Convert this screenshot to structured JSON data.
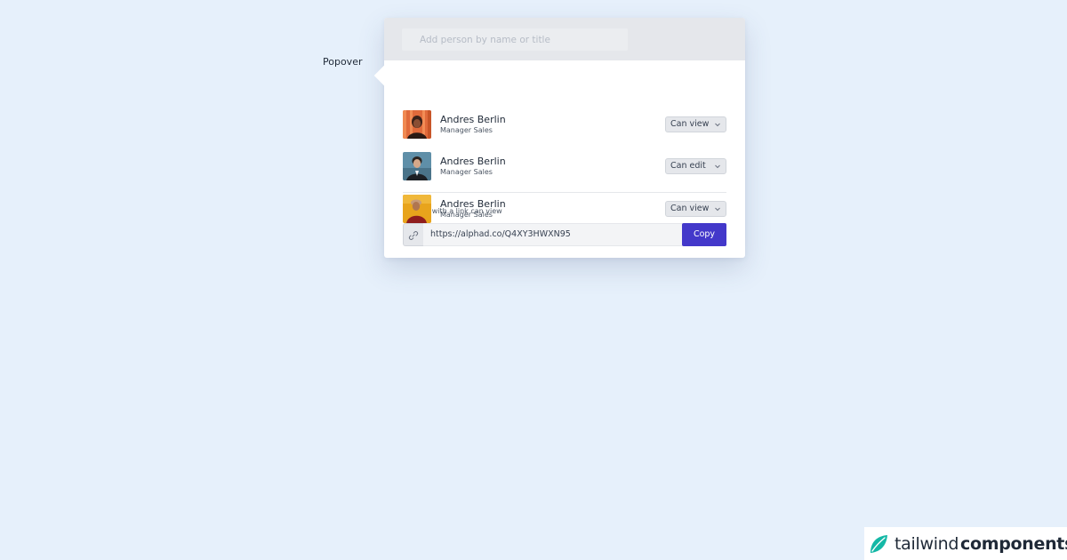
{
  "trigger": {
    "label": "Popover"
  },
  "search": {
    "placeholder": "Add person by name or title",
    "value": ""
  },
  "people": [
    {
      "name": "Andres Berlin",
      "title": "Manager Sales",
      "permission": "Can view",
      "avatar": "person-photo-orange"
    },
    {
      "name": "Andres Berlin",
      "title": "Manager Sales",
      "permission": "Can edit",
      "avatar": "person-photo-blue"
    },
    {
      "name": "Andres Berlin",
      "title": "Manager Sales",
      "permission": "Can view",
      "avatar": "person-photo-yellow"
    }
  ],
  "share": {
    "label": "Anyone with a link can view",
    "url": "https://alphad.co/Q4XY3HWXN95",
    "copy_label": "Copy",
    "link_icon": "link-icon"
  },
  "brand": {
    "part1": "tailwind",
    "part2": "components",
    "icon": "leaf-icon"
  },
  "colors": {
    "background": "#e6f0fb",
    "accent": "#4338ca",
    "brand_leaf": "#14b8a6"
  }
}
